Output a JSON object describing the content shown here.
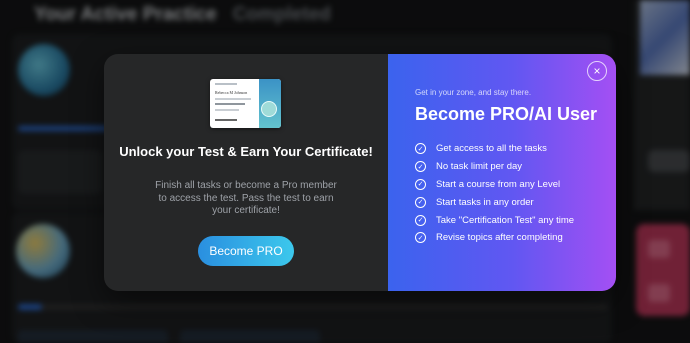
{
  "background": {
    "tabs": [
      "Your Active Practice",
      "Completed"
    ]
  },
  "modal": {
    "left": {
      "certificate": {
        "name": "Rebecca M Johnson",
        "course": "The Simulated Course"
      },
      "title": "Unlock your Test & Earn Your Certificate!",
      "description": "Finish all tasks or become a Pro member to access the test. Pass the test to earn your certificate!",
      "button_label": "Become PRO"
    },
    "right": {
      "close_icon": "×",
      "tagline": "Get in your zone, and stay there.",
      "title": "Become PRO/AI User",
      "check_icon": "✓",
      "features": [
        "Get access to all the tasks",
        "No task limit per day",
        "Start a course from any Level",
        "Start tasks in any order",
        "Take \"Certification Test\" any time",
        "Revise topics after completing"
      ]
    }
  },
  "colors": {
    "gradient_start": "#3b63ee",
    "gradient_end": "#a44ff3",
    "button_start": "#2a8fe0",
    "button_end": "#3cc8ec",
    "left_panel": "#262728"
  }
}
